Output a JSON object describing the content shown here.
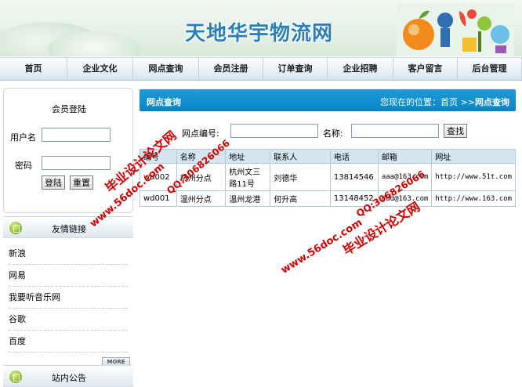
{
  "header": {
    "site_title": "天地华宇物流网"
  },
  "nav": {
    "items": [
      {
        "label": "首页",
        "w": 86
      },
      {
        "label": "企业文化",
        "w": 84
      },
      {
        "label": "网点查询",
        "w": 84
      },
      {
        "label": "会员注册",
        "w": 82
      },
      {
        "label": "订单查询",
        "w": 82
      },
      {
        "label": "企业招聘",
        "w": 84
      },
      {
        "label": "客户留言",
        "w": 82
      },
      {
        "label": "后台管理",
        "w": 82
      }
    ]
  },
  "login": {
    "title": "会员登陆",
    "username_label": "用户名",
    "password_label": "密码",
    "login_button": "登陆",
    "reset_button": "重置"
  },
  "friend_links": {
    "title": "友情链接",
    "items": [
      "新浪",
      "网易",
      "我要听音乐网",
      "谷歌",
      "百度"
    ],
    "more": "MORE"
  },
  "announcements": {
    "title": "站内公告"
  },
  "main": {
    "title": "网点查询",
    "location_prefix": "您现在的位置：首页 >>",
    "location_current": "网点查询",
    "search": {
      "code_label": "网点编号:",
      "name_label": "名称:",
      "button": "查找"
    },
    "table": {
      "headers": [
        "编号",
        "名称",
        "地址",
        "联系人",
        "电话",
        "邮箱",
        "网址"
      ],
      "rows": [
        [
          "wd002",
          "杭州分点",
          "杭州文三路11号",
          "刘德华",
          "13814546",
          "aaa@163.com",
          "http://www.51t.com"
        ],
        [
          "wd001",
          "温州分点",
          "温州龙港",
          "何升高",
          "13148452",
          "ddd@163.com",
          "http://www.163.com"
        ]
      ]
    }
  },
  "watermark": {
    "text_a": "毕业设计论文网",
    "text_b": "www.56doc.com",
    "text_c": "QQ:306826066"
  },
  "colors": {
    "accent": "#0c84c4",
    "title": "#2a7fb8",
    "watermark": "#d40000"
  }
}
